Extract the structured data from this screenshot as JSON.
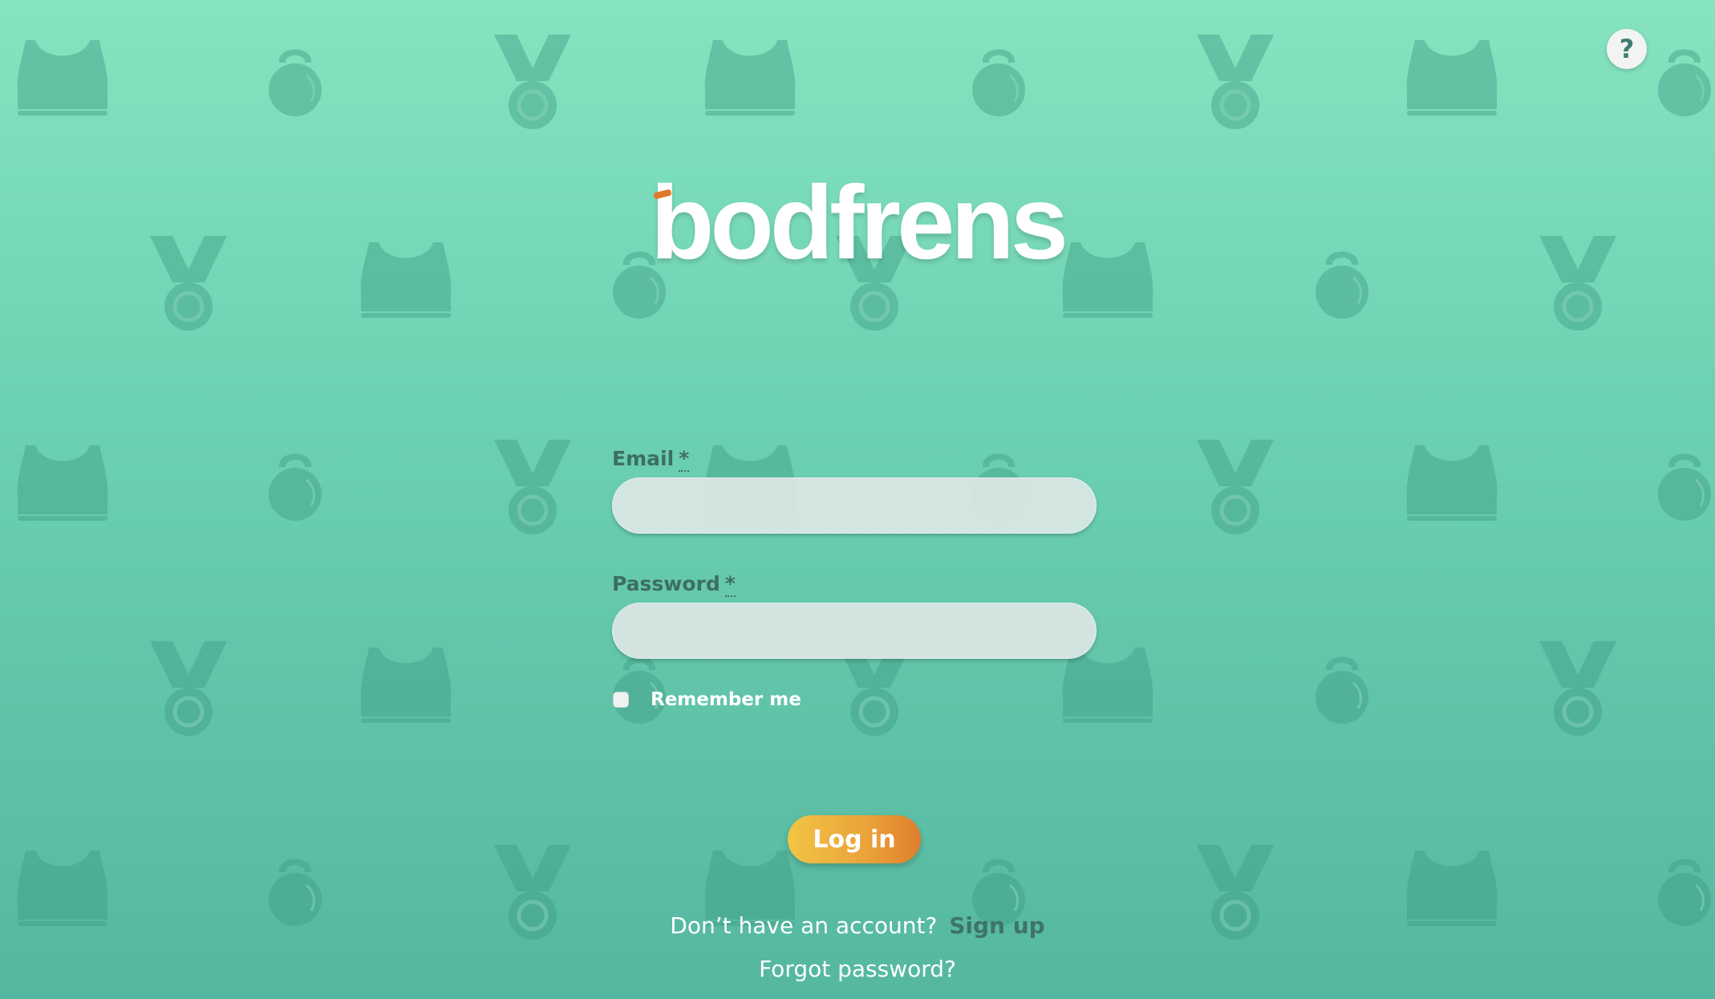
{
  "app": {
    "logo_text": "bodfrens"
  },
  "help": {
    "icon": "question-mark-icon",
    "symbol": "?"
  },
  "form": {
    "email": {
      "label": "Email",
      "required_marker": "*",
      "value": "",
      "placeholder": ""
    },
    "password": {
      "label": "Password",
      "required_marker": "*",
      "value": "",
      "placeholder": ""
    },
    "remember_me": {
      "label": "Remember me",
      "checked": false
    },
    "submit_label": "Log in"
  },
  "footer": {
    "no_account_text": "Don’t have an account?",
    "signup_label": "Sign up",
    "forgot_password_label": "Forgot password?"
  },
  "background": {
    "pattern_icons": [
      "sports-bra-icon",
      "kettlebell-icon",
      "medal-icon"
    ]
  },
  "colors": {
    "background_top": "#86e4bf",
    "background_bottom": "#55b7a0",
    "logo_accent": "#e07a2b",
    "button_gradient_start": "#f2c544",
    "button_gradient_end": "#de7e2e",
    "label_text": "#3d6e62"
  }
}
